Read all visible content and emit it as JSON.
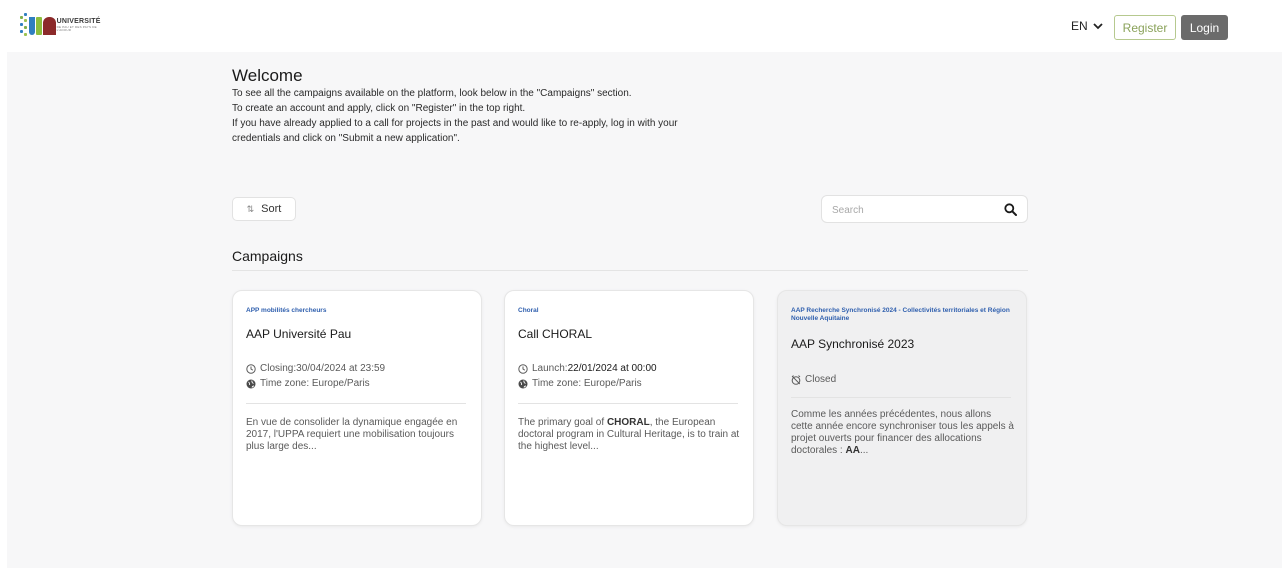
{
  "header": {
    "logo_text": "UNIVERSITÉ",
    "logo_subtext": "DE PAU ET DES PAYS DE L'ADOUR",
    "language": "EN",
    "register_label": "Register",
    "login_label": "Login"
  },
  "welcome": {
    "title": "Welcome",
    "lines": [
      "To see all the campaigns available on the platform, look below in the \"Campaigns\" section.",
      "To create an account and apply, click on \"Register\" in the top right.",
      "If you have already applied to a call for projects in the past and would like to re-apply, log in with your",
      "credentials and click on \"Submit a new application\"."
    ]
  },
  "toolbar": {
    "sort_label": "Sort",
    "search_placeholder": "Search"
  },
  "campaigns": {
    "title": "Campaigns",
    "cards": [
      {
        "tag": "APP mobilités chercheurs",
        "title": "AAP Université Pau",
        "date_label": "Closing: ",
        "date_value": "30/04/2024 at 23:59",
        "timezone": "Time zone: Europe/Paris",
        "desc_1": "En vue de consolider la dynamique engagée en 2017, l'UPPA requiert une mobilisation toujours plus large des...",
        "desc_bold": "",
        "desc_2": ""
      },
      {
        "tag": "Choral",
        "title": "Call CHORAL",
        "date_label": "Launch: ",
        "date_value": "22/01/2024 at 00:00",
        "timezone": "Time zone: Europe/Paris",
        "desc_1": "The primary goal of ",
        "desc_bold": "CHORAL",
        "desc_2": ", the European doctoral program in Cultural Heritage, is to train at the highest level..."
      },
      {
        "tag": "AAP Recherche Synchronisé 2024 - Collectivités territoriales et Région Nouvelle Aquitaine",
        "title": "AAP Synchronisé 2023",
        "status": "Closed",
        "desc_1": "Comme les années précédentes, nous allons cette année encore synchroniser tous les appels à projet ouverts pour financer des allocations doctorales : ",
        "desc_bold": "AA",
        "desc_2": "..."
      }
    ]
  },
  "colors": {
    "accent_blue": "#2f5fae",
    "register_green": "#8aa25a",
    "login_gray": "#6b6b6b",
    "page_bg": "#f7f7f8"
  }
}
